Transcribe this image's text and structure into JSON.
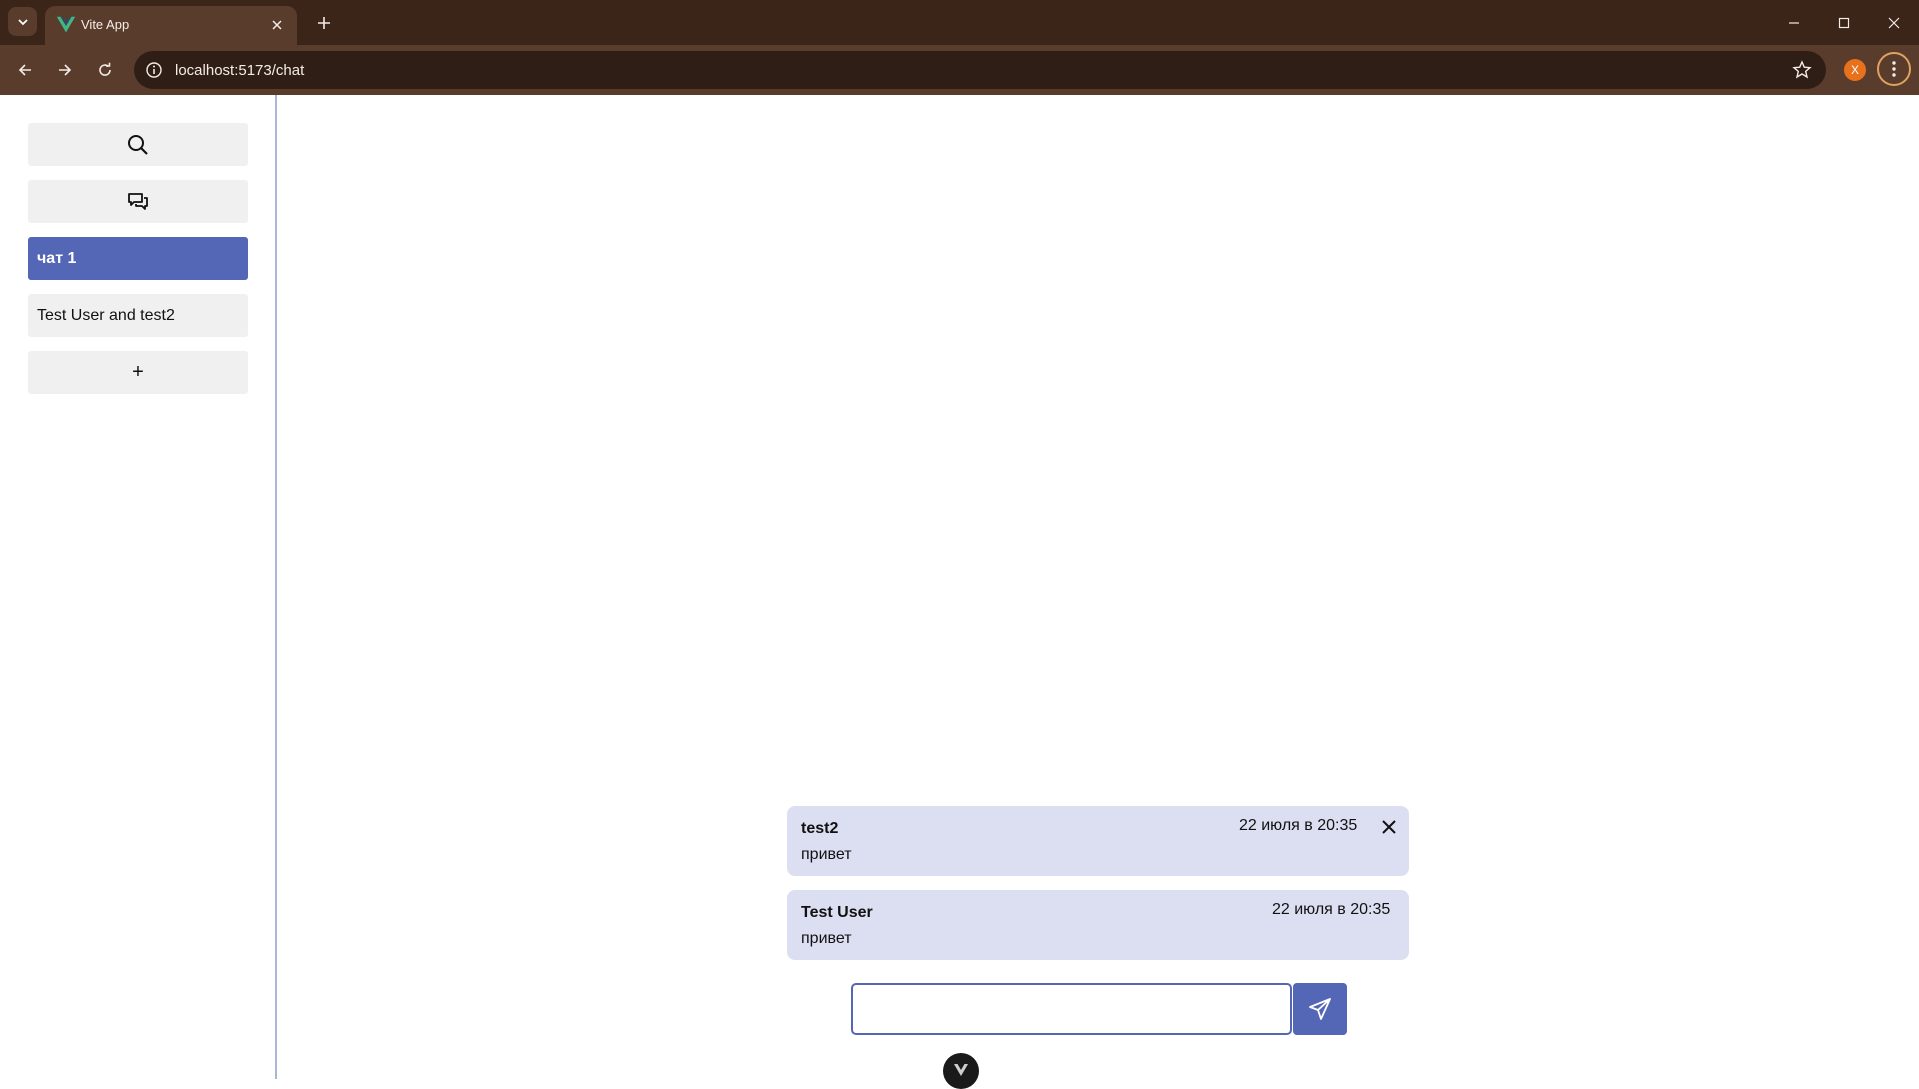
{
  "browser": {
    "tab_title": "Vite App",
    "url": "localhost:5173/chat",
    "profile_initial": "X"
  },
  "sidebar": {
    "search_icon": "search-icon",
    "chats_icon": "chat-bubbles-icon",
    "chats": [
      {
        "label": "чат 1",
        "active": true
      },
      {
        "label": "Test User and test2",
        "active": false
      }
    ],
    "add_label": "+"
  },
  "messages": [
    {
      "author": "test2",
      "text": "привет",
      "time": "22 июля в 20:35",
      "deletable": true
    },
    {
      "author": "Test User",
      "text": "привет",
      "time": "22 июля в 20:35",
      "deletable": false
    }
  ],
  "compose": {
    "value": "",
    "placeholder": ""
  },
  "colors": {
    "accent": "#5466b6",
    "message_bg": "#dcdff1",
    "chrome_dark": "#3b2418",
    "chrome": "#5a3c2c"
  }
}
